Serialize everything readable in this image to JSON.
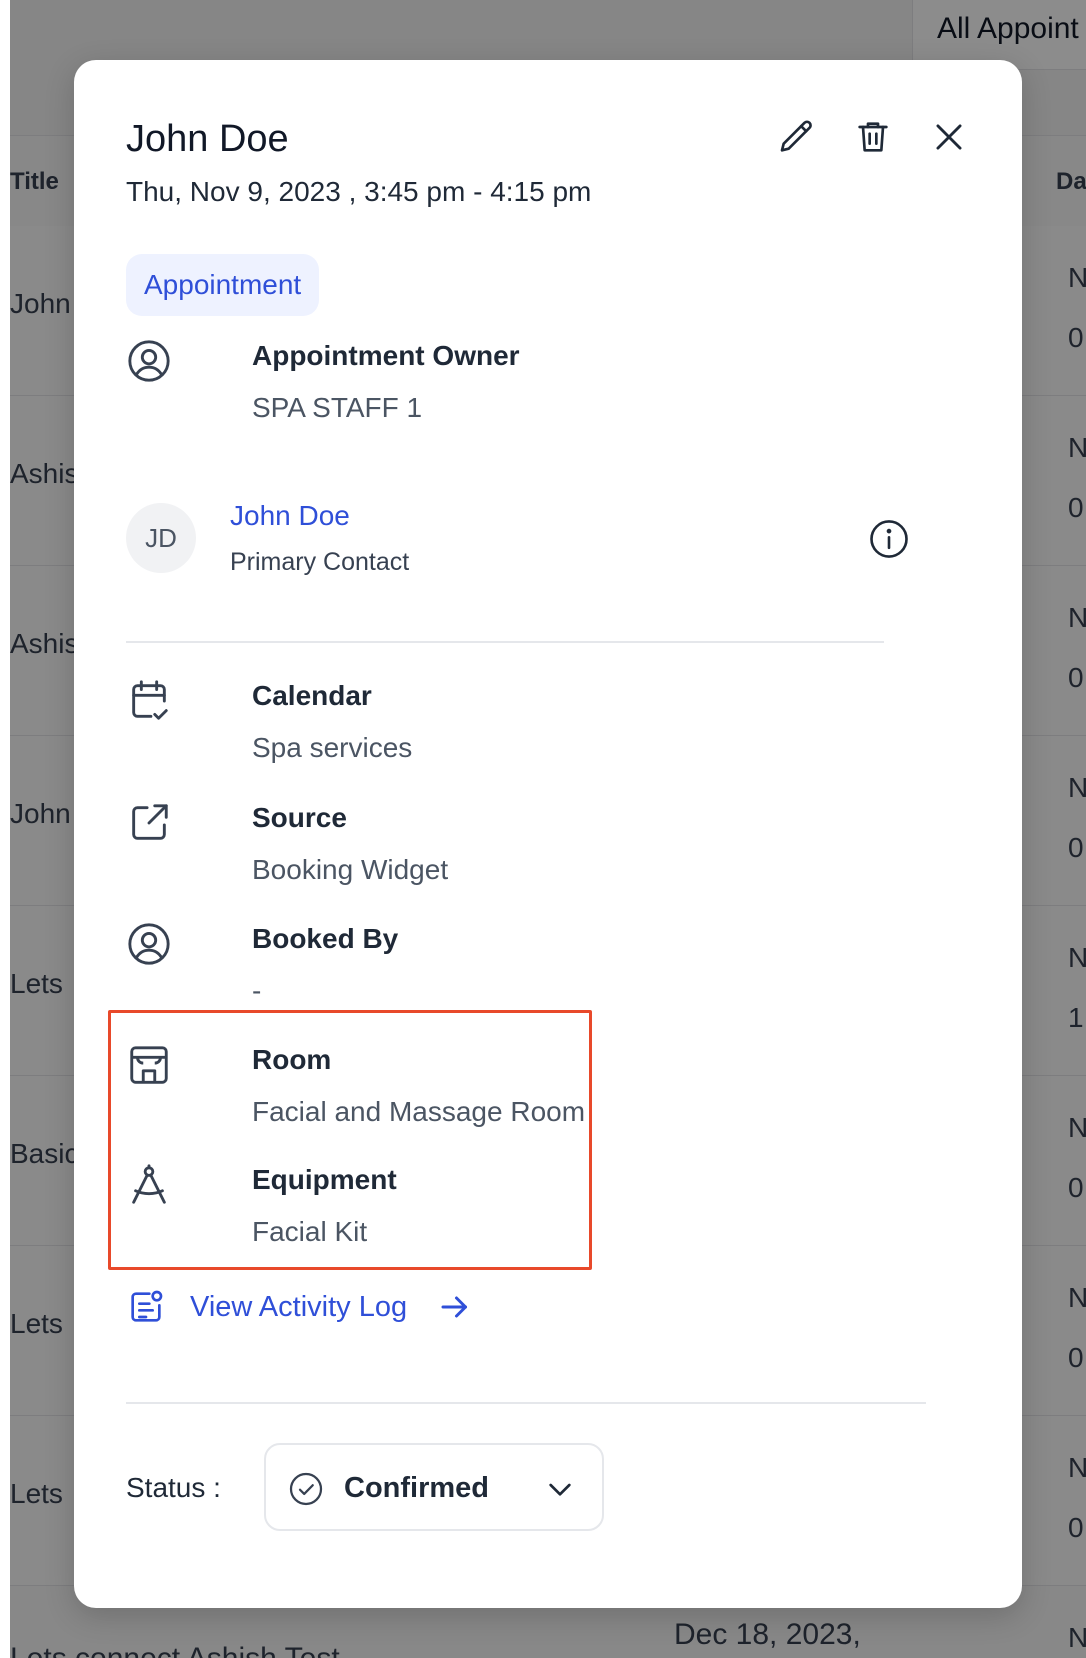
{
  "background": {
    "view_selector": "All Appoint",
    "columns": {
      "title": "Title",
      "date": "Da"
    },
    "rows": [
      {
        "title": "John",
        "d1": "N",
        "d2": "0"
      },
      {
        "title": "Ashis",
        "d1": "N",
        "d2": "0"
      },
      {
        "title": "Ashis",
        "d1": "N",
        "d2": "0"
      },
      {
        "title": "John",
        "d1": "N",
        "d2": "0"
      },
      {
        "title": "Lets",
        "d1": "N",
        "d2": "1"
      },
      {
        "title": "Basic",
        "d1": "N",
        "d2": "0"
      },
      {
        "title": "Lets",
        "d1": "N",
        "d2": "0"
      },
      {
        "title": "Lets",
        "d1": "N",
        "d2": "0"
      }
    ],
    "last_row": {
      "title": "Lets connect Ashish Test",
      "date": "Dec 18, 2023,",
      "d1": "N"
    }
  },
  "modal": {
    "title": "John Doe",
    "datetime": "Thu, Nov 9, 2023 , 3:45 pm - 4:15 pm",
    "actions": {
      "edit_icon": "pencil-icon",
      "delete_icon": "trash-icon",
      "close_icon": "close-icon"
    },
    "type_chip": "Appointment",
    "owner": {
      "label": "Appointment Owner",
      "value": "SPA STAFF 1",
      "icon": "user-circle-icon"
    },
    "contact": {
      "initials": "JD",
      "name": "John Doe",
      "role": "Primary Contact",
      "info_icon": "info-icon"
    },
    "calendar": {
      "label": "Calendar",
      "value": "Spa services",
      "icon": "calendar-check-icon"
    },
    "source": {
      "label": "Source",
      "value": "Booking Widget",
      "icon": "external-link-icon"
    },
    "booked_by": {
      "label": "Booked By",
      "value": "-",
      "icon": "user-circle-icon"
    },
    "room": {
      "label": "Room",
      "value": "Facial and Massage Room",
      "icon": "room-icon"
    },
    "equipment": {
      "label": "Equipment",
      "value": "Facial Kit",
      "icon": "compass-icon"
    },
    "activity_log": {
      "label": "View Activity Log",
      "icon": "activity-log-icon",
      "arrow_icon": "arrow-right-icon"
    },
    "status": {
      "label": "Status :",
      "value": "Confirmed",
      "icon": "check-circle-icon",
      "chevron_icon": "chevron-down-icon"
    },
    "colors": {
      "link": "#2f4fd8",
      "chip_bg": "#eef2ff",
      "highlight": "#e8492a"
    }
  }
}
